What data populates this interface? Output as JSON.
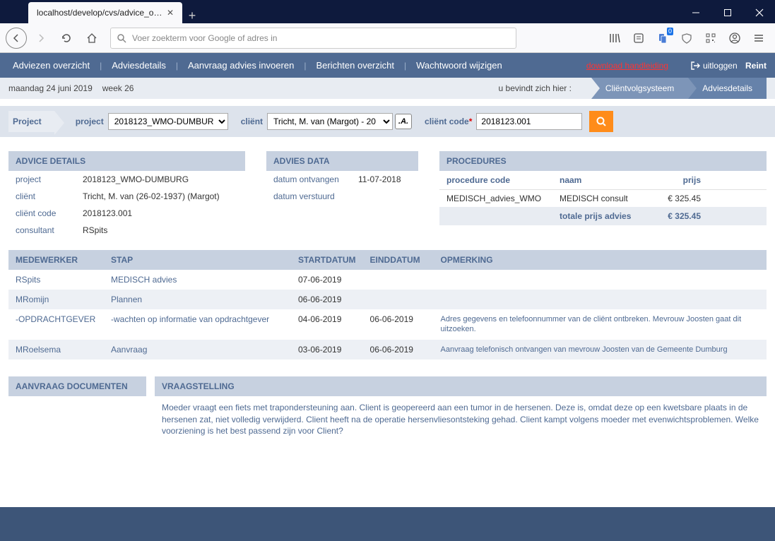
{
  "browser": {
    "tab_title": "localhost/develop/cvs/advice_over…",
    "search_placeholder": "Voer zoekterm voor Google of adres in",
    "notif_count": "0"
  },
  "nav": {
    "items": [
      "Adviezen overzicht",
      "Adviesdetails",
      "Aanvraag advies invoeren",
      "Berichten overzicht",
      "Wachtwoord wijzigen"
    ],
    "download": "download handleiding",
    "logout_text": "uitloggen",
    "user": "Reint"
  },
  "subheader": {
    "date": "maandag 24 juni 2019",
    "week": "week 26",
    "here": "u bevindt zich hier :",
    "bc1": "Cliëntvolgsysteem",
    "bc2": "Adviesdetails"
  },
  "projectbar": {
    "title": "Project",
    "project_label": "project",
    "project_value": "2018123_WMO-DUMBURG",
    "client_label": "cliënt",
    "client_value": "Tricht, M. van (Margot) - 20",
    "anon": ".A.",
    "code_label": "cliënt code",
    "code_value": "2018123.001"
  },
  "advice_details": {
    "title": "ADVICE DETAILS",
    "rows": [
      {
        "k": "project",
        "v": "2018123_WMO-DUMBURG"
      },
      {
        "k": "cliënt",
        "v": "Tricht, M. van (26-02-1937) (Margot)"
      },
      {
        "k": "cliënt code",
        "v": "2018123.001"
      },
      {
        "k": "consultant",
        "v": "RSpits"
      }
    ]
  },
  "advies_data": {
    "title": "ADVIES DATA",
    "rows": [
      {
        "k": "datum ontvangen",
        "v": "11-07-2018"
      },
      {
        "k": "datum verstuurd",
        "v": ""
      }
    ]
  },
  "procedures": {
    "title": "PROCEDURES",
    "h1": "procedure code",
    "h2": "naam",
    "h3": "prijs",
    "rows": [
      {
        "code": "MEDISCH_advies_WMO",
        "naam": "MEDISCH consult",
        "prijs": "€ 325.45"
      }
    ],
    "total_label": "totale prijs advies",
    "total": "€ 325.45"
  },
  "workflow": {
    "headers": [
      "MEDEWERKER",
      "STAP",
      "STARTDATUM",
      "EINDDATUM",
      "OPMERKING"
    ],
    "rows": [
      {
        "m": "RSpits",
        "s": "MEDISCH advies",
        "sd": "07-06-2019",
        "ed": "",
        "op": ""
      },
      {
        "m": "MRomijn",
        "s": "Plannen",
        "sd": "06-06-2019",
        "ed": "",
        "op": ""
      },
      {
        "m": "-OPDRACHTGEVER",
        "s": "-wachten op informatie van opdrachtgever",
        "sd": "04-06-2019",
        "ed": "06-06-2019",
        "op": "Adres gegevens en telefoonnummer van de cliënt ontbreken. Mevrouw Joosten gaat dit uitzoeken."
      },
      {
        "m": "MRoelsema",
        "s": "Aanvraag",
        "sd": "03-06-2019",
        "ed": "06-06-2019",
        "op": "Aanvraag telefonisch ontvangen van mevrouw Joosten van de Gemeente Dumburg"
      }
    ]
  },
  "docs": {
    "title": "AANVRAAG DOCUMENTEN"
  },
  "vraag": {
    "title": "VRAAGSTELLING",
    "text": "Moeder vraagt een fiets met trapondersteuning aan. Client is geopereerd aan een tumor in de hersenen. Deze is, omdat deze op een kwetsbare plaats in de hersenen zat, niet volledig verwijderd. Client heeft na de operatie hersenvliesontsteking gehad. Client kampt volgens moeder met evenwichtsproblemen. Welke voorziening is het best passend zijn voor Client?"
  }
}
